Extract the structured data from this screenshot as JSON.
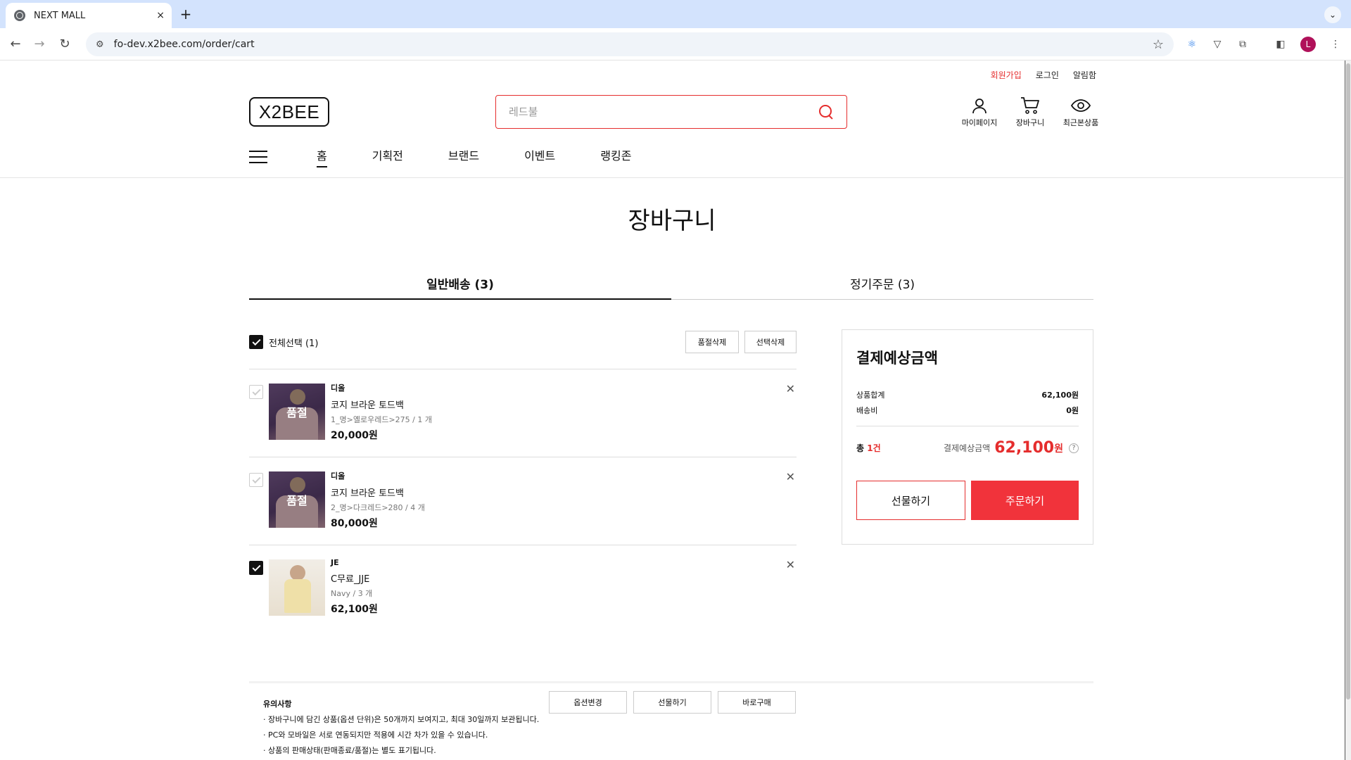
{
  "browser": {
    "tab_title": "NEXT MALL",
    "tab_close": "×",
    "new_tab": "+",
    "url": "fo-dev.x2bee.com/order/cart",
    "avatar_letter": "L"
  },
  "header": {
    "util_links": {
      "signup": "회원가입",
      "login": "로그인",
      "alarm": "알림함"
    },
    "logo": "X2BEE",
    "search_placeholder": "레드불",
    "icons": {
      "mypage": "마이페이지",
      "cart": "장바구니",
      "recent": "최근본상품"
    },
    "gnb": [
      "홈",
      "기획전",
      "브랜드",
      "이벤트",
      "랭킹존"
    ]
  },
  "page": {
    "title": "장바구니",
    "tabs": [
      "일반배송 (3)",
      "정기주문 (3)"
    ]
  },
  "cart": {
    "select_all": "전체선택 (1)",
    "delete_soldout": "품절삭제",
    "delete_selected": "선택삭제",
    "soldout_label": "품절",
    "items": [
      {
        "brand": "디올",
        "name": "코지 브라운 토드백",
        "option": "1_명>옐로우레드>275 / 1 개",
        "price": "20,000원",
        "soldout": true,
        "checked": false
      },
      {
        "brand": "디올",
        "name": "코지 브라운 토드백",
        "option": "2_명>다크레드>280 / 4 개",
        "price": "80,000원",
        "soldout": true,
        "checked": false
      },
      {
        "brand": "JE",
        "name": "C무료_JJE",
        "option": "Navy / 3 개",
        "price": "62,100원",
        "soldout": false,
        "checked": true
      }
    ],
    "bottom_buttons": [
      "옵션변경",
      "선물하기",
      "바로구매"
    ]
  },
  "summary": {
    "title": "결제예상금액",
    "product_total_label": "상품합계",
    "product_total_value": "62,100원",
    "shipping_label": "배송비",
    "shipping_value": "0원",
    "count_prefix": "총 ",
    "count_num": "1건",
    "expected_label": "결제예상금액",
    "expected_amount": "62,100",
    "expected_unit": "원",
    "help": "?",
    "gift_button": "선물하기",
    "order_button": "주문하기"
  },
  "notice": {
    "title": "유의사항",
    "items": [
      "장바구니에 담긴 상품(옵션 단위)은 50개까지 보여지고, 최대 30일까지 보관됩니다.",
      "PC와 모바일은 서로 연동되지만 적용에 시간 차가 있을 수 있습니다.",
      "상품의 판매상태(판매종료/품절)는 별도 표기됩니다."
    ]
  },
  "colors": {
    "accent": "#e52d2d",
    "order_button": "#f1333b",
    "tabbar": "#d3e3fd"
  }
}
